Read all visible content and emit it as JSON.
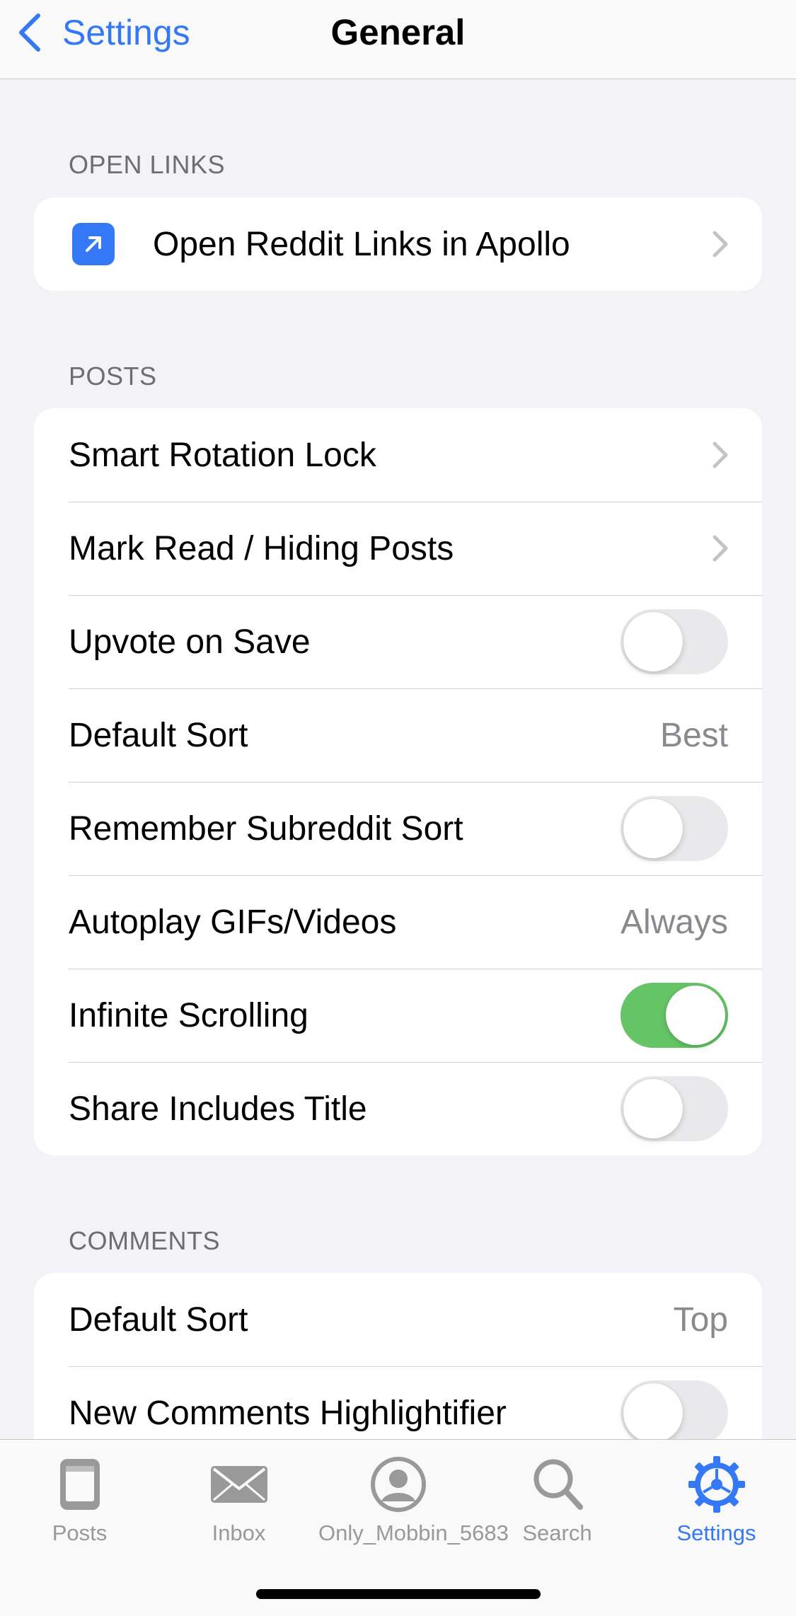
{
  "nav": {
    "back_label": "Settings",
    "title": "General"
  },
  "sections": {
    "open_links": {
      "header": "OPEN LINKS",
      "row_label": "Open Reddit Links in Apollo"
    },
    "posts": {
      "header": "POSTS",
      "rows": [
        {
          "label": "Smart Rotation Lock",
          "type": "chevron"
        },
        {
          "label": "Mark Read / Hiding Posts",
          "type": "chevron"
        },
        {
          "label": "Upvote on Save",
          "type": "toggle",
          "on": false
        },
        {
          "label": "Default Sort",
          "type": "value",
          "value": "Best"
        },
        {
          "label": "Remember Subreddit Sort",
          "type": "toggle",
          "on": false
        },
        {
          "label": "Autoplay GIFs/Videos",
          "type": "value",
          "value": "Always"
        },
        {
          "label": "Infinite Scrolling",
          "type": "toggle",
          "on": true
        },
        {
          "label": "Share Includes Title",
          "type": "toggle",
          "on": false
        }
      ]
    },
    "comments": {
      "header": "COMMENTS",
      "rows": [
        {
          "label": "Default Sort",
          "type": "value",
          "value": "Top"
        },
        {
          "label": "New Comments Highlightifier",
          "type": "toggle",
          "on": false
        }
      ]
    }
  },
  "tabbar": {
    "tabs": [
      {
        "label": "Posts",
        "icon": "posts-icon"
      },
      {
        "label": "Inbox",
        "icon": "inbox-icon"
      },
      {
        "label": "Only_Mobbin_5683",
        "icon": "profile-icon"
      },
      {
        "label": "Search",
        "icon": "search-icon"
      },
      {
        "label": "Settings",
        "icon": "settings-gear-icon",
        "active": true
      }
    ]
  },
  "colors": {
    "accent": "#3478f6",
    "toggle_on": "#65c466",
    "background": "#f2f2f7"
  }
}
